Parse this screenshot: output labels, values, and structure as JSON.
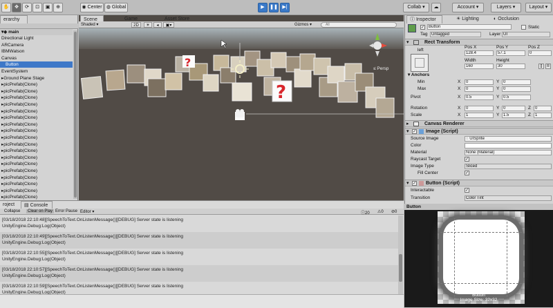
{
  "toolbar": {
    "center_label": "Center",
    "global_label": "Global",
    "collab_label": "Collab ▾",
    "account_label": "Account",
    "layers_label": "Layers",
    "layout_label": "Layout"
  },
  "hierarchy": {
    "tab_label": "erarchy",
    "scene_name": "main",
    "items": [
      "Directional Light",
      "ARCamera",
      "IBMWatson",
      "Canvas",
      "Button",
      "EventSystem",
      "Ground Plane Stage",
      "picPrefab(Clone)",
      "picPrefab(Clone)",
      "picPrefab(Clone)",
      "picPrefab(Clone)",
      "picPrefab(Clone)",
      "picPrefab(Clone)",
      "picPrefab(Clone)",
      "picPrefab(Clone)",
      "picPrefab(Clone)",
      "picPrefab(Clone)",
      "picPrefab(Clone)",
      "picPrefab(Clone)",
      "picPrefab(Clone)",
      "picPrefab(Clone)",
      "picPrefab(Clone)",
      "picPrefab(Clone)",
      "picPrefab(Clone)",
      "picPrefab(Clone)"
    ]
  },
  "scene_view": {
    "tabs": [
      "Scene",
      "Game",
      "Asset Store"
    ],
    "shading": "Shaded",
    "mode_2d": "2D",
    "gizmos": "Gizmos",
    "search_placeholder": "All",
    "persp_label": "≤ Persp"
  },
  "inspector": {
    "tabs": [
      "Inspector",
      "Lighting",
      "Occlusion"
    ],
    "object_name": "Button",
    "static_label": "Static",
    "tag_label": "Tag",
    "tag_value": "Untagged",
    "layer_label": "Layer",
    "layer_value": "UI",
    "rect_transform": {
      "title": "Rect Transform",
      "anchor_preset": "left",
      "pos_x_label": "Pos X",
      "pos_y_label": "Pos Y",
      "pos_z_label": "Pos Z",
      "pos_x": "128.4",
      "pos_y": "57.1",
      "pos_z": "0",
      "width_label": "Width",
      "height_label": "Height",
      "width": "160",
      "height": "30",
      "anchors_label": "Anchors",
      "min_label": "Min",
      "min_x": "0",
      "min_y": "0",
      "max_label": "Max",
      "max_x": "0",
      "max_y": "0",
      "pivot_label": "Pivot",
      "pivot_x": "0.5",
      "pivot_y": "0.5",
      "rotation_label": "Rotation",
      "rot_x": "0",
      "rot_y": "0",
      "rot_z": "0",
      "scale_label": "Scale",
      "scale_x": "1",
      "scale_y": "1.5",
      "scale_z": "1"
    },
    "canvas_renderer": {
      "title": "Canvas Renderer"
    },
    "image": {
      "title": "Image (Script)",
      "source_image_label": "Source Image",
      "source_image_value": "UISprite",
      "color_label": "Color",
      "material_label": "Material",
      "material_value": "None (Material)",
      "raycast_label": "Raycast Target",
      "image_type_label": "Image Type",
      "image_type_value": "Sliced",
      "fill_center_label": "Fill Center"
    },
    "button": {
      "title": "Button (Script)",
      "interactable_label": "Interactable",
      "transition_label": "Transition",
      "transition_value": "Color Tint"
    }
  },
  "console": {
    "tabs": [
      "roject",
      "Console"
    ],
    "buttons": [
      "Collapse",
      "Clear on Play",
      "Error Pause",
      "Editor ▾"
    ],
    "count_log": "20",
    "count_warn": "0",
    "count_err": "0",
    "entries": [
      {
        "line1": "[03/18/2018 22:10:48][SpeechToText.OnListenMessage()][DEBUG] Server state is listening",
        "line2": "UnityEngine.Debug:Log(Object)"
      },
      {
        "line1": "[03/18/2018 22:10:49][SpeechToText.OnListenMessage()][DEBUG] Server state is listening",
        "line2": "UnityEngine.Debug:Log(Object)"
      },
      {
        "line1": "[03/18/2018 22:10:55][SpeechToText.OnListenMessage()][DEBUG] Server state is listening",
        "line2": "UnityEngine.Debug:Log(Object)"
      },
      {
        "line1": "[03/18/2018 22:10:57][SpeechToText.OnListenMessage()][DEBUG] Server state is listening",
        "line2": "UnityEngine.Debug:Log(Object)"
      },
      {
        "line1": "[03/18/2018 22:10:59][SpeechToText.OnListenMessage()][DEBUG] Server state is listening",
        "line2": "UnityEngine.Debug:Log(Object)"
      }
    ]
  },
  "preview": {
    "title": "Button",
    "caption1": "Button",
    "caption2": "Image Size: 32x32"
  }
}
